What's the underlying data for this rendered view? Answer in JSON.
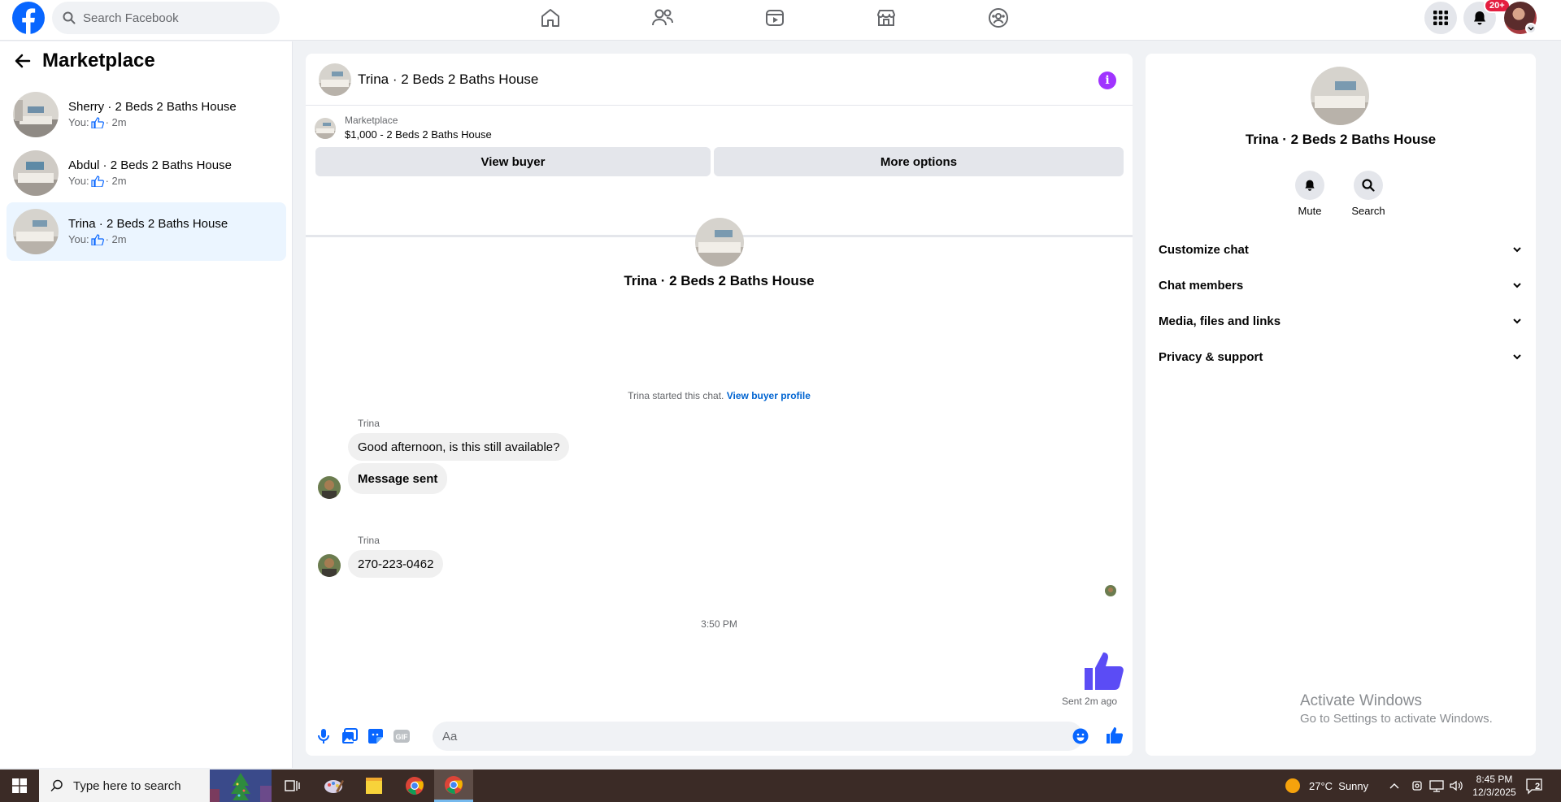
{
  "topbar": {
    "search_placeholder": "Search Facebook",
    "notifications_badge": "20+"
  },
  "left_panel": {
    "title": "Marketplace",
    "conversations": [
      {
        "name": "Sherry · 2 Beds 2 Baths House",
        "prefix": "You:",
        "time": "· 2m",
        "active": false
      },
      {
        "name": "Abdul · 2 Beds 2 Baths House",
        "prefix": "You:",
        "time": "· 2m",
        "active": false
      },
      {
        "name": "Trina · 2 Beds 2 Baths House",
        "prefix": "You:",
        "time": "· 2m",
        "active": true
      }
    ]
  },
  "chat": {
    "header_name": "Trina · 2 Beds 2 Baths House",
    "marketplace_label": "Marketplace",
    "listing": "$1,000 - 2 Beds 2 Baths House",
    "view_buyer_label": "View buyer",
    "more_options_label": "More options",
    "center_name": "Trina · 2 Beds 2 Baths House",
    "started_text": "Trina started this chat.",
    "view_buyer_profile": "View buyer profile",
    "messages": [
      {
        "sender": "Trina",
        "text": "Good afternoon, is this still available?"
      },
      {
        "sender": "",
        "text": "Message sent"
      },
      {
        "sender": "Trina",
        "text": "270-223-0462"
      }
    ],
    "timestamp": "3:50 PM",
    "sent_status": "Sent 2m ago",
    "composer_placeholder": "Aa",
    "gif_label": "GIF"
  },
  "right_panel": {
    "name": "Trina · 2 Beds 2 Baths House",
    "actions": [
      {
        "label": "Mute"
      },
      {
        "label": "Search"
      }
    ],
    "sections": [
      "Customize chat",
      "Chat members",
      "Media, files and links",
      "Privacy & support"
    ]
  },
  "watermark": {
    "line1": "Activate Windows",
    "line2": "Go to Settings to activate Windows."
  },
  "taskbar": {
    "search_placeholder": "Type here to search",
    "weather": "27°C  Sunny",
    "time": "8:45 PM",
    "date": "12/3/2025",
    "notification_count": "2"
  },
  "colors": {
    "brand": "#0866ff",
    "messenger_accent": "#5b4cf5",
    "info": "#a033ff"
  }
}
